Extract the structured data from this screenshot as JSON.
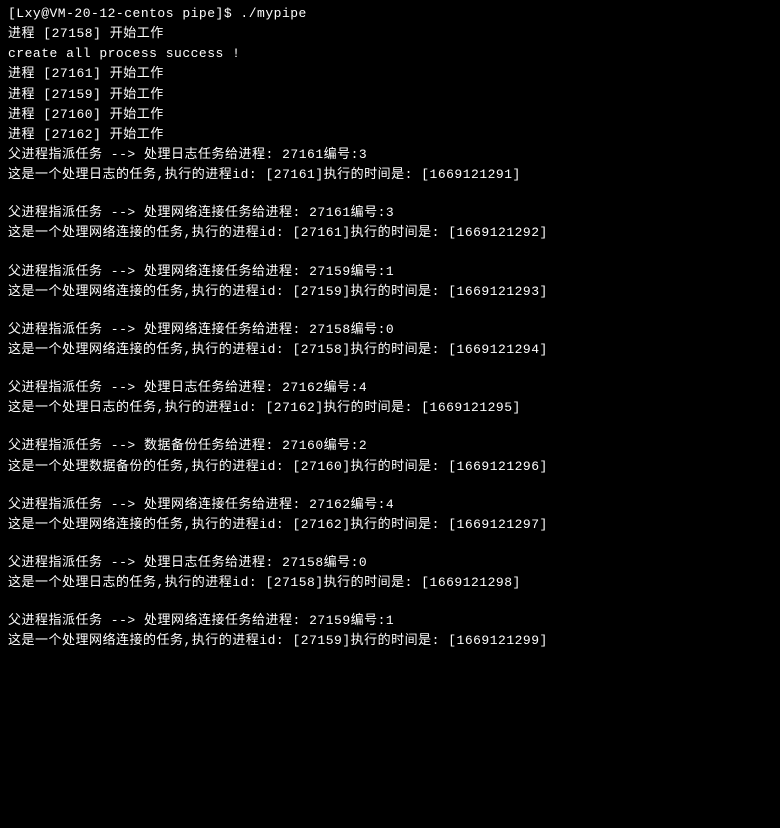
{
  "prompt": "[Lxy@VM-20-12-centos pipe]$ ./mypipe",
  "startLines": [
    "进程 [27158] 开始工作",
    "create all process success !",
    "进程 [27161] 开始工作",
    "进程 [27159] 开始工作",
    "进程 [27160] 开始工作",
    "进程 [27162] 开始工作"
  ],
  "tasks": [
    {
      "assign": "父进程指派任务 --> 处理日志任务给进程: 27161编号:3",
      "exec": "这是一个处理日志的任务,执行的进程id: [27161]执行的时间是: [1669121291]"
    },
    {
      "assign": "父进程指派任务 --> 处理网络连接任务给进程: 27161编号:3",
      "exec": "这是一个处理网络连接的任务,执行的进程id: [27161]执行的时间是: [1669121292]"
    },
    {
      "assign": "父进程指派任务 --> 处理网络连接任务给进程: 27159编号:1",
      "exec": "这是一个处理网络连接的任务,执行的进程id: [27159]执行的时间是: [1669121293]"
    },
    {
      "assign": "父进程指派任务 --> 处理网络连接任务给进程: 27158编号:0",
      "exec": "这是一个处理网络连接的任务,执行的进程id: [27158]执行的时间是: [1669121294]"
    },
    {
      "assign": "父进程指派任务 --> 处理日志任务给进程: 27162编号:4",
      "exec": "这是一个处理日志的任务,执行的进程id: [27162]执行的时间是: [1669121295]"
    },
    {
      "assign": "父进程指派任务 --> 数据备份任务给进程: 27160编号:2",
      "exec": "这是一个处理数据备份的任务,执行的进程id: [27160]执行的时间是: [1669121296]"
    },
    {
      "assign": "父进程指派任务 --> 处理网络连接任务给进程: 27162编号:4",
      "exec": "这是一个处理网络连接的任务,执行的进程id: [27162]执行的时间是: [1669121297]"
    },
    {
      "assign": "父进程指派任务 --> 处理日志任务给进程: 27158编号:0",
      "exec": "这是一个处理日志的任务,执行的进程id: [27158]执行的时间是: [1669121298]"
    },
    {
      "assign": "父进程指派任务 --> 处理网络连接任务给进程: 27159编号:1",
      "exec": "这是一个处理网络连接的任务,执行的进程id: [27159]执行的时间是: [1669121299]"
    }
  ]
}
